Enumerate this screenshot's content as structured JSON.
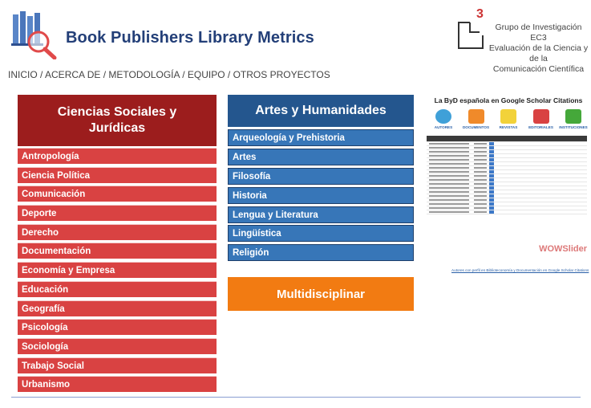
{
  "header": {
    "title": "Book Publishers Library Metrics",
    "logo_icon": "books-magnifier-icon",
    "ec3": {
      "line1": "Grupo de Investigación EC3",
      "line2": "Evaluación de la Ciencia y de la",
      "line3": "Comunicación Científica",
      "logo_digit": "3"
    }
  },
  "nav": {
    "items": [
      "INICIO",
      "ACERCA DE",
      "METODOLOGÍA",
      "EQUIPO",
      "OTROS PROYECTOS"
    ],
    "separator": " / "
  },
  "columns": {
    "social": {
      "title": "Ciencias Sociales y Jurídicas",
      "color": "#9c1d1d",
      "items": [
        "Antropología",
        "Ciencia Política",
        "Comunicación",
        "Deporte",
        "Derecho",
        "Documentación",
        "Economía y Empresa",
        "Educación",
        "Geografía",
        "Psicología",
        "Sociología",
        "Trabajo Social",
        "Urbanismo"
      ]
    },
    "humanities": {
      "title": "Artes y Humanidades",
      "color": "#24568e",
      "items": [
        "Arqueología y Prehistoria",
        "Artes",
        "Filosofía",
        "Historia",
        "Lengua y Literatura",
        "Lingüística",
        "Religión"
      ]
    },
    "multi": {
      "title": "Multidisciplinar",
      "color": "#f27b12"
    }
  },
  "slider": {
    "title": "La ByD española en Google Scholar Citations",
    "icons": [
      "AUTORES",
      "DOCUMENTOS",
      "REVISTAS",
      "EDITORIALES",
      "INSTITUCIONES"
    ],
    "watermark": "WOWSlider",
    "caption": "Autores con perfil en Biblioteconomía y Documentación en Google Scholar Citations"
  }
}
